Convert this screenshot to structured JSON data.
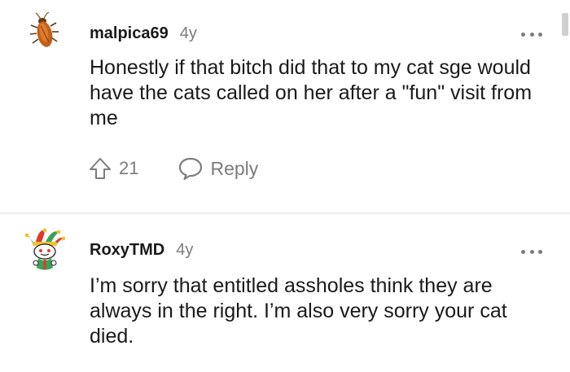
{
  "comments": [
    {
      "username": "malpica69",
      "age": "4y",
      "avatar_icon": "cockroach-avatar-icon",
      "body": "Honestly if that bitch did that to my cat sge would have the cats called on her after a \"fun\" visit from me",
      "upvotes": "21",
      "reply_label": "Reply",
      "more_icon": "more-options-icon"
    },
    {
      "username": "RoxyTMD",
      "age": "4y",
      "avatar_icon": "jester-snoo-avatar-icon",
      "body": "I’m sorry that entitled assholes think they are always in the right. I’m also very sorry your cat died.",
      "more_icon": "more-options-icon"
    }
  ],
  "colors": {
    "text": "#1a1a1b",
    "muted": "#7c7c7c",
    "divider": "#ececec",
    "jester_green": "#3aa35a",
    "jester_red": "#e0392b"
  }
}
